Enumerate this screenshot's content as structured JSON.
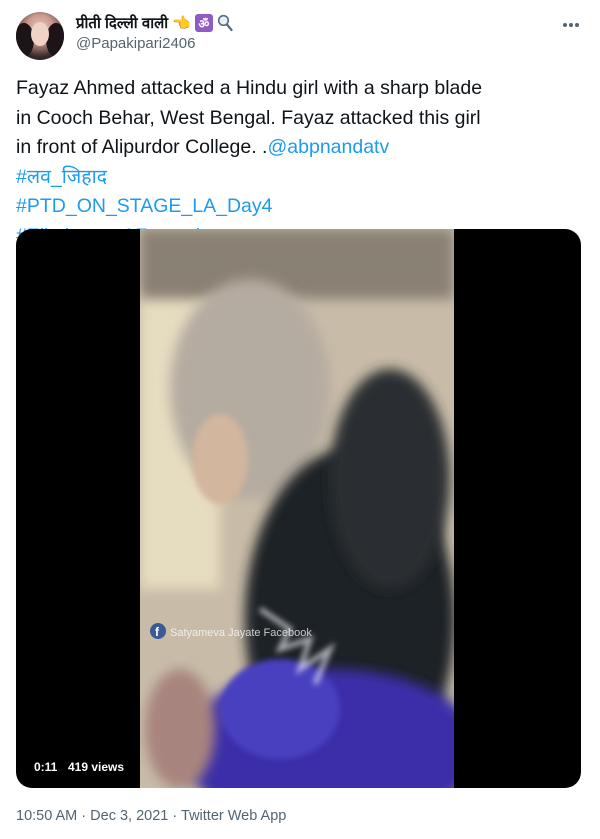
{
  "tweet": {
    "author": {
      "display_name": "प्रीती दिल्ली वाली",
      "emojis": [
        "👈",
        "ॐ",
        "magnifier-icon"
      ],
      "handle": "@Papakipari2406"
    },
    "text_lines": [
      "Fayaz Ahmed attacked a Hindu girl with a sharp blade",
      "in Cooch Behar, West Bengal. Fayaz attacked this girl",
      "in front of Alipurdor College. ."
    ],
    "mention": "@abpnandatv",
    "hashtags": [
      "#लव_जिहाद",
      "#PTD_ON_STAGE_LA_Day4",
      "#EliminacaoAFazenda"
    ],
    "video": {
      "duration": "0:11",
      "views": "419 views",
      "watermark": "Satyameva Jayate Facebook"
    },
    "time": "10:50 AM",
    "separator": "·",
    "date": "Dec 3, 2021",
    "source": "Twitter Web App"
  },
  "colors": {
    "text": "#0f1419",
    "secondary": "#536471",
    "link": "#1d9bf0",
    "media_background": "#000000"
  }
}
